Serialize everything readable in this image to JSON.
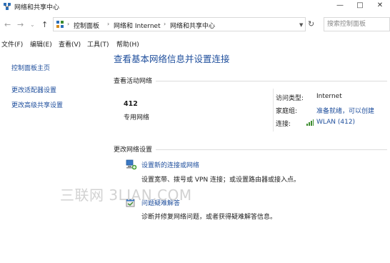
{
  "window": {
    "title": "网络和共享中心",
    "controls": [
      "—",
      "□",
      "✕"
    ]
  },
  "address_bar": {
    "breadcrumbs": [
      "控制面板",
      "网络和 Internet",
      "网络和共享中心"
    ],
    "search_placeholder": "搜索控制面板"
  },
  "menu": [
    "文件(F)",
    "编辑(E)",
    "查看(V)",
    "工具(T)",
    "帮助(H)"
  ],
  "sidebar": {
    "items": [
      "控制面板主页",
      "更改适配器设置",
      "更改高级共享设置"
    ]
  },
  "main": {
    "title": "查看基本网络信息并设置连接",
    "active_networks_heading": "查看活动网络",
    "network": {
      "name": "412",
      "type": "专用网络",
      "access_type_label": "访问类型:",
      "access_type_value": "Internet",
      "homegroup_label": "家庭组:",
      "homegroup_value": "准备就绪，可以创建",
      "connections_label": "连接:",
      "connections_value": "WLAN (412)"
    },
    "change_settings_heading": "更改网络设置",
    "tasks": [
      {
        "link": "设置新的连接或网络",
        "description": "设置宽带、拨号或 VPN 连接；或设置路由器或接入点。"
      },
      {
        "link": "问题疑难解答",
        "description": "诊断并修复网络问题，或者获得疑难解答信息。"
      }
    ]
  },
  "watermark": "三联网 3LIAN.COM",
  "colors": {
    "link": "#1e4e9c",
    "text": "#1e1e1e",
    "separator": "#dcdcdc",
    "wifi": "#3c8c2e"
  }
}
